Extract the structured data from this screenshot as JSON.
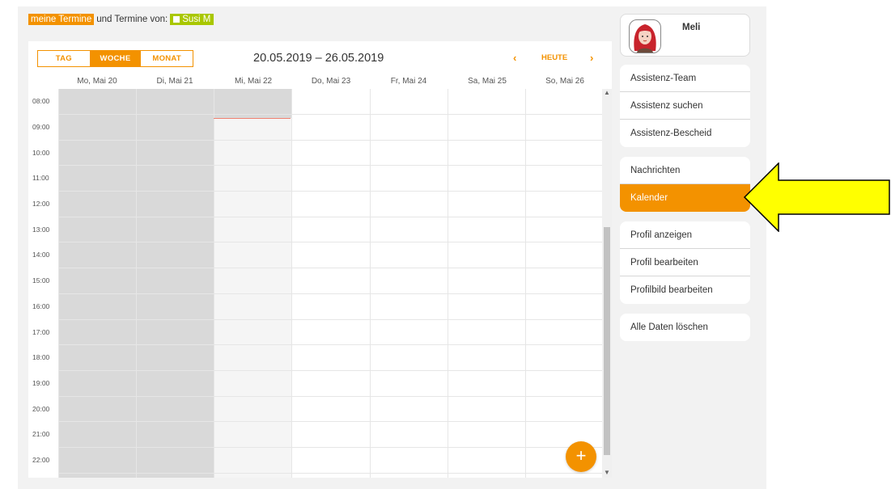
{
  "filter": {
    "my_appointments": "meine Termine",
    "appointments_from": "und Termine von:",
    "person": "Susi M"
  },
  "calendar": {
    "views": [
      {
        "label": "TAG",
        "active": false
      },
      {
        "label": "WOCHE",
        "active": true
      },
      {
        "label": "MONAT",
        "active": false
      }
    ],
    "date_range": "20.05.2019 – 26.05.2019",
    "prev": "‹",
    "today": "HEUTE",
    "next": "›",
    "days": [
      "Mo, Mai 20",
      "Di, Mai 21",
      "Mi, Mai 22",
      "Do, Mai 23",
      "Fr, Mai 24",
      "Sa, Mai 25",
      "So, Mai 26"
    ],
    "hours": [
      "08:00",
      "09:00",
      "10:00",
      "11:00",
      "12:00",
      "13:00",
      "14:00",
      "15:00",
      "16:00",
      "17:00",
      "18:00",
      "19:00",
      "20:00",
      "21:00",
      "22:00"
    ],
    "add_button": "+",
    "colors": {
      "accent": "#f39200",
      "past": "#d9d9d9",
      "today": "#f5f5f5",
      "now_line": "#f08070"
    }
  },
  "profile": {
    "name": "Meli"
  },
  "menu": {
    "group1": [
      "Assistenz-Team",
      "Assistenz suchen",
      "Assistenz-Bescheid"
    ],
    "group2": [
      "Nachrichten",
      "Kalender"
    ],
    "group3": [
      "Profil anzeigen",
      "Profil bearbeiten",
      "Profilbild bearbeiten"
    ],
    "group4": [
      "Alle Daten löschen"
    ],
    "active": "Kalender"
  },
  "annotation": {
    "arrow_color": "#ffff00"
  }
}
